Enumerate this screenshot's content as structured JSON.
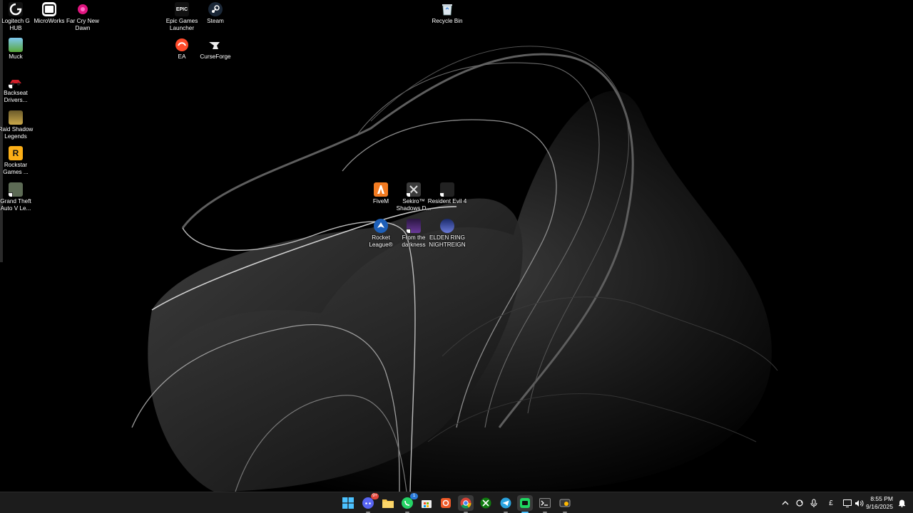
{
  "desktop": {
    "icons": {
      "logitech": "Logitech G HUB",
      "microworks": "MicroWorks",
      "farcry": "Far Cry New Dawn",
      "epic": "Epic Games Launcher",
      "steam": "Steam",
      "recycle": "Recycle Bin",
      "muck": "Muck",
      "ea": "EA",
      "curseforge": "CurseForge",
      "backseat": "Backseat Drivers...",
      "raid": "Raid Shadow Legends",
      "rockstar": "Rockstar Games ...",
      "gta": "Grand Theft Auto V Le...",
      "fivem": "FiveM",
      "sekiro": "Sekiro™ Shadows D...",
      "re4": "Resident Evil 4",
      "rocket": "Rocket League®",
      "fromdark": "From the darkness",
      "eldenring": "ELDEN RING NIGHTREIGN"
    },
    "epic_glyph": "EPIC",
    "rockstar_glyph": "R"
  },
  "taskbar": {
    "apps": [
      "windows-start",
      "discord",
      "file-explorer",
      "whatsapp",
      "microsoft-store",
      "snipping-tool",
      "chrome",
      "xbox",
      "telegram",
      "app-active",
      "terminal",
      "gamebar"
    ],
    "discord_badge": "9+",
    "whatsapp_badge": "1",
    "clock_time": "8:55 PM",
    "clock_date": "9/16/2025",
    "tray_lang": "£"
  },
  "colors": {
    "taskbar_bg": "#1c1c1c",
    "accent": "#4cc2ff"
  }
}
